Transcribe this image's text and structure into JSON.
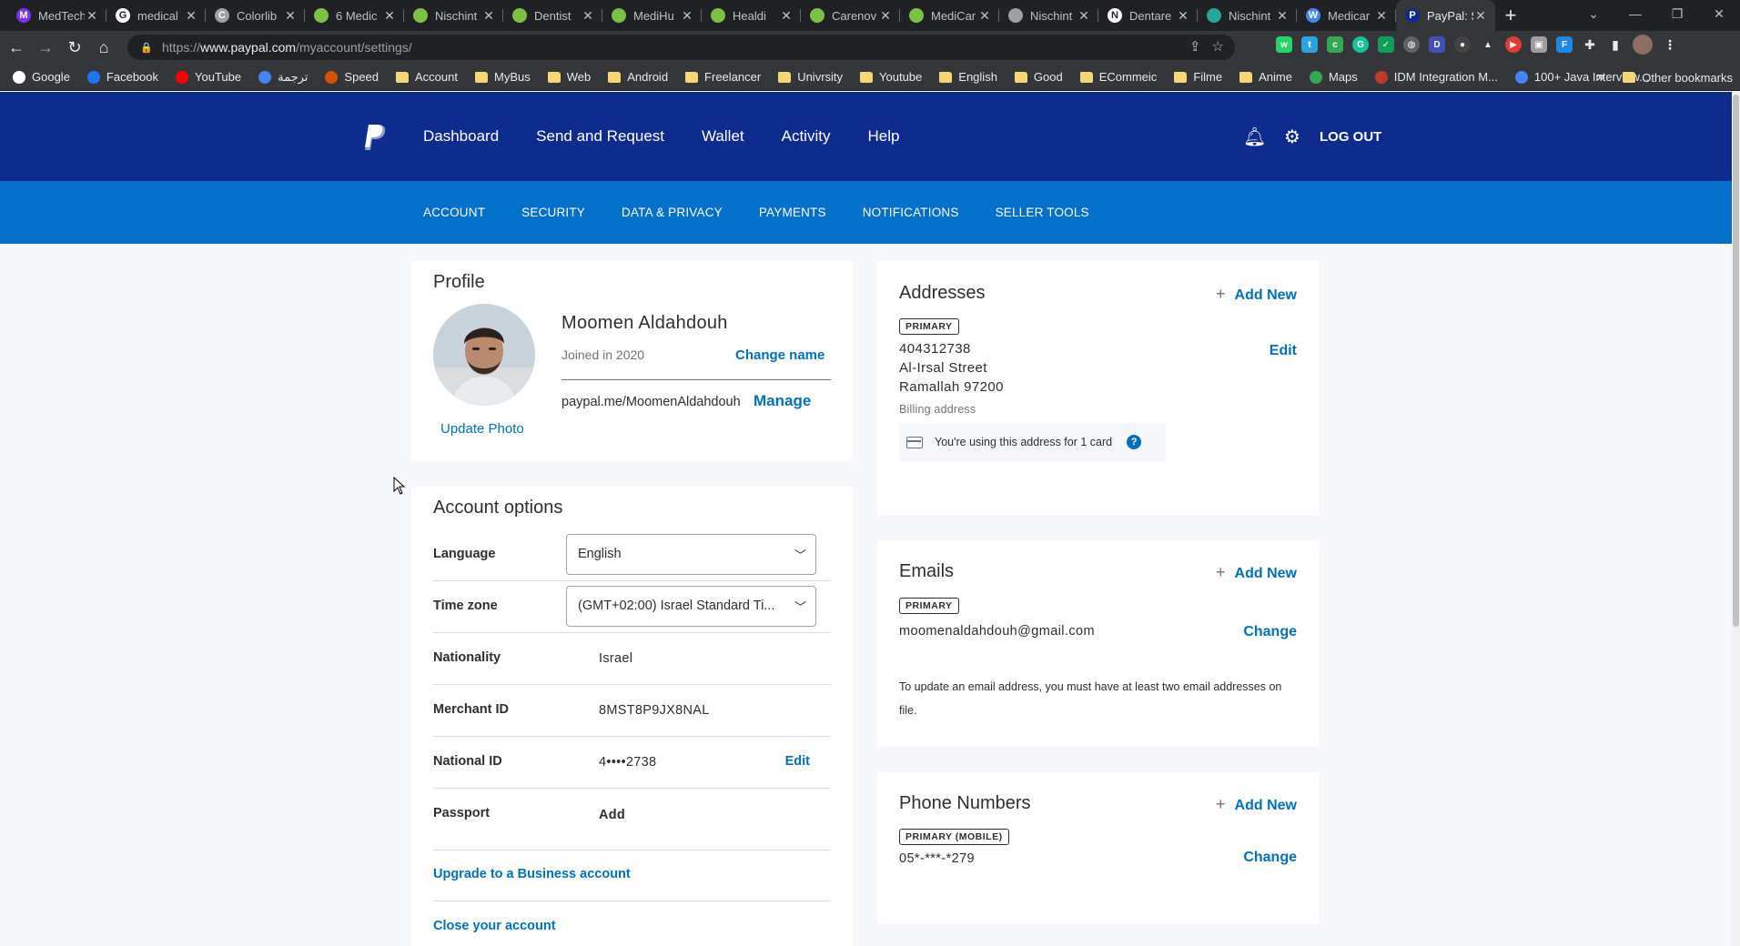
{
  "browser": {
    "tabs": [
      {
        "title": "MedTech",
        "fav": "M",
        "color": "#7b2ff7"
      },
      {
        "title": "medical",
        "fav": "G",
        "color": "#ffffff"
      },
      {
        "title": "Colorlib",
        "fav": "C",
        "color": "#9aa0a6"
      },
      {
        "title": "6 Medic",
        "fav": "",
        "color": "#7cc242"
      },
      {
        "title": "Nischint",
        "fav": "",
        "color": "#7cc242"
      },
      {
        "title": "Dentist",
        "fav": "",
        "color": "#7cc242"
      },
      {
        "title": "MediHu",
        "fav": "",
        "color": "#7cc242"
      },
      {
        "title": "Healdi",
        "fav": "",
        "color": "#7cc242"
      },
      {
        "title": "Carenov",
        "fav": "",
        "color": "#7cc242"
      },
      {
        "title": "MediCar",
        "fav": "",
        "color": "#7cc242"
      },
      {
        "title": "Nischint",
        "fav": "",
        "color": "#9aa0a6"
      },
      {
        "title": "Dentare",
        "fav": "N",
        "color": "#ffffff"
      },
      {
        "title": "Nischint",
        "fav": "",
        "color": "#26a69a"
      },
      {
        "title": "Medicar",
        "fav": "W",
        "color": "#4285f4"
      },
      {
        "title": "PayPal: S",
        "fav": "P",
        "color": "#0e2c8e",
        "active": true
      }
    ],
    "url_prefix": "https://",
    "url_domain": "www.paypal.com",
    "url_path": "/myaccount/settings/",
    "bookmarks": [
      {
        "label": "Google",
        "type": "google"
      },
      {
        "label": "Facebook",
        "type": "facebook"
      },
      {
        "label": "YouTube",
        "type": "youtube"
      },
      {
        "label": "ترجمة",
        "type": "translate"
      },
      {
        "label": "Speed",
        "type": "speed"
      },
      {
        "label": "Account",
        "type": "folder"
      },
      {
        "label": "MyBus",
        "type": "folder"
      },
      {
        "label": "Web",
        "type": "folder"
      },
      {
        "label": "Android",
        "type": "folder"
      },
      {
        "label": "Freelancer",
        "type": "folder"
      },
      {
        "label": "Univrsity",
        "type": "folder"
      },
      {
        "label": "Youtube",
        "type": "folder"
      },
      {
        "label": "English",
        "type": "folder"
      },
      {
        "label": "Good",
        "type": "folder"
      },
      {
        "label": "ECommeic",
        "type": "folder"
      },
      {
        "label": "Filme",
        "type": "folder"
      },
      {
        "label": "Anime",
        "type": "folder"
      },
      {
        "label": "Maps",
        "type": "maps"
      },
      {
        "label": "IDM Integration M...",
        "type": "idm"
      },
      {
        "label": "100+ Java Interview...",
        "type": "java"
      }
    ],
    "bookmarks_overflow": "»",
    "other_bookmarks": "Other bookmarks"
  },
  "header": {
    "nav": [
      "Dashboard",
      "Send and Request",
      "Wallet",
      "Activity",
      "Help"
    ],
    "logout": "LOG OUT"
  },
  "subnav": [
    "ACCOUNT",
    "SECURITY",
    "DATA & PRIVACY",
    "PAYMENTS",
    "NOTIFICATIONS",
    "SELLER TOOLS"
  ],
  "profile": {
    "title": "Profile",
    "name": "Moomen Aldahdouh",
    "joined": "Joined in 2020",
    "change_name": "Change name",
    "paypalme": "paypal.me/MoomenAldahdouh",
    "manage": "Manage",
    "update_photo": "Update Photo"
  },
  "account_options": {
    "title": "Account options",
    "language_label": "Language",
    "language_value": "English",
    "timezone_label": "Time zone",
    "timezone_value": "(GMT+02:00) Israel Standard Ti...",
    "nationality_label": "Nationality",
    "nationality_value": "Israel",
    "merchant_label": "Merchant ID",
    "merchant_value": "8MST8P9JX8NAL",
    "national_label": "National ID",
    "national_value": "4••••2738",
    "national_action": "Edit",
    "passport_label": "Passport",
    "passport_action": "Add",
    "upgrade": "Upgrade to a Business account",
    "close": "Close your account"
  },
  "addresses": {
    "title": "Addresses",
    "add_new": "Add New",
    "badge": "PRIMARY",
    "line1": "404312738",
    "line2": "Al-Irsal Street",
    "line3": "Ramallah 97200",
    "type": "Billing address",
    "edit": "Edit",
    "notice": "You're using this address for 1 card",
    "help": "?"
  },
  "emails": {
    "title": "Emails",
    "add_new": "Add New",
    "badge": "PRIMARY",
    "email": "moomenaldahdouh@gmail.com",
    "change": "Change",
    "note": "To update an email address, you must have at least two email addresses on file."
  },
  "phones": {
    "title": "Phone Numbers",
    "add_new": "Add New",
    "badge": "PRIMARY (MOBILE)",
    "number": "05*-***-*279",
    "change": "Change"
  }
}
